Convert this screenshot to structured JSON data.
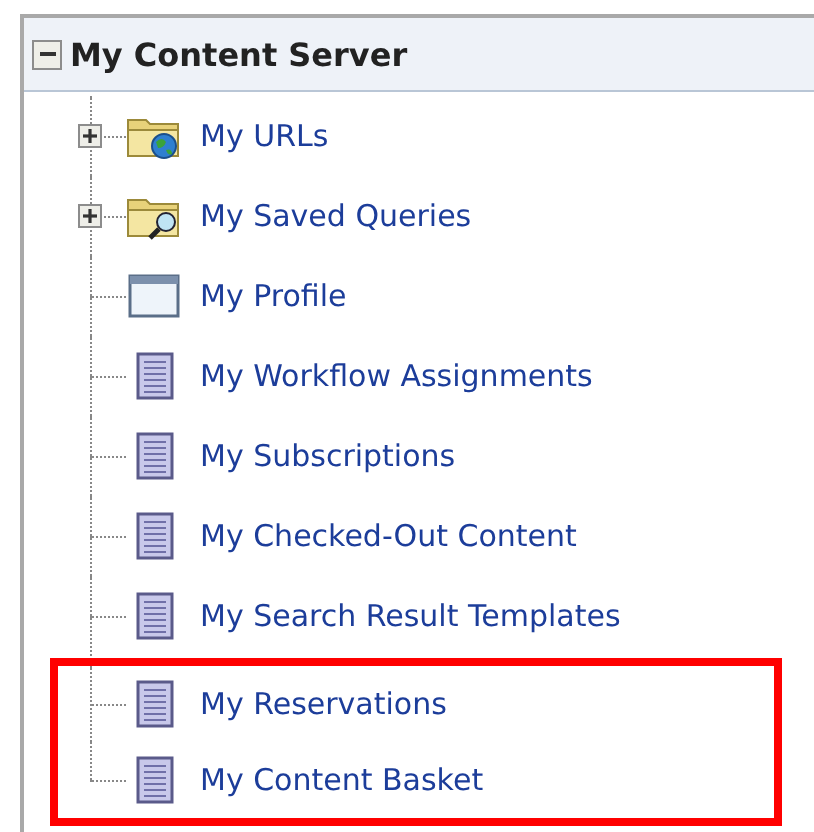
{
  "tree": {
    "label": "My Content Server",
    "expanded": true,
    "children": [
      {
        "label": "My URLs",
        "kind": "web-folder",
        "expanded": false,
        "highlighted": false
      },
      {
        "label": "My Saved Queries",
        "kind": "search-folder",
        "expanded": false,
        "highlighted": false
      },
      {
        "label": "My Profile",
        "kind": "form",
        "highlighted": false
      },
      {
        "label": "My Workflow Assignments",
        "kind": "page",
        "highlighted": false
      },
      {
        "label": "My Subscriptions",
        "kind": "page",
        "highlighted": false
      },
      {
        "label": "My Checked-Out Content",
        "kind": "page",
        "highlighted": false
      },
      {
        "label": "My Search Result Templates",
        "kind": "page",
        "highlighted": false
      },
      {
        "label": "My Reservations",
        "kind": "page",
        "highlighted": true
      },
      {
        "label": "My Content Basket",
        "kind": "page",
        "highlighted": true
      }
    ]
  }
}
